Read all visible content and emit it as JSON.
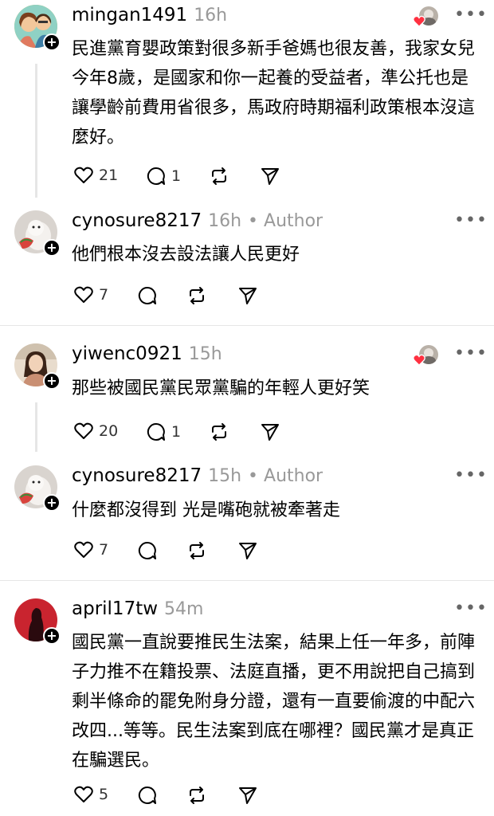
{
  "comments": [
    {
      "username": "mingan1491",
      "time": "16h",
      "author_tag": "",
      "text": "民進黨育嬰政策對很多新手爸媽也很友善，我家女兒今年8歲，是國家和你一起養的受益者，準公托也是讓學齡前費用省很多，馬政府時期福利政策根本沒這麼好。",
      "likes": "21",
      "replies": "1"
    },
    {
      "username": "cynosure8217",
      "time": "16h",
      "author_tag": "• Author",
      "text": "他們根本沒去設法讓人民更好",
      "likes": "7",
      "replies": ""
    },
    {
      "username": "yiwenc0921",
      "time": "15h",
      "author_tag": "",
      "text": "那些被國民黨民眾黨騙的年輕人更好笑",
      "likes": "20",
      "replies": "1"
    },
    {
      "username": "cynosure8217",
      "time": "15h",
      "author_tag": "• Author",
      "text": "什麼都沒得到 光是嘴砲就被牽著走",
      "likes": "7",
      "replies": ""
    },
    {
      "username": "april17tw",
      "time": "54m",
      "author_tag": "",
      "text": "國民黨一直說要推民生法案，結果上任一年多，前陣子力推不在籍投票、法庭直播，更不用說把自己搞到剩半條命的罷免附身分證，還有一直要偷渡的中配六改四...等等。民生法案到底在哪裡？國民黨才是真正在騙選民。",
      "likes": "5",
      "replies": ""
    }
  ],
  "icons": {
    "like": "heart-icon",
    "reply": "reply-bubble-icon",
    "repost": "repost-icon",
    "share": "share-send-icon",
    "more": "more-dots-icon",
    "follow": "plus-follow-icon"
  },
  "colors": {
    "heart_liked": "#ff3040",
    "text": "#000000",
    "meta": "#999999",
    "separator": "#e6e6e6"
  }
}
